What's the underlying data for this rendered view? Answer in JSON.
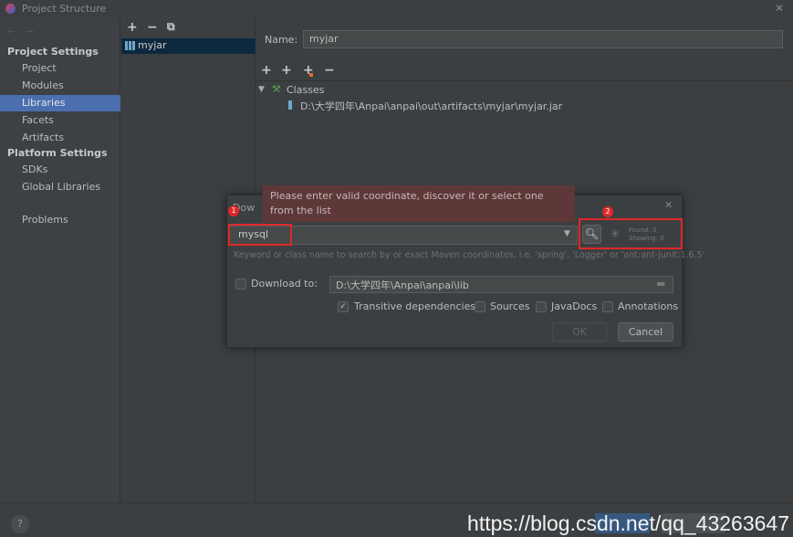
{
  "window": {
    "title": "Project Structure",
    "close": "✕"
  },
  "nav": {
    "back": "←",
    "forward": "→"
  },
  "sidebar": {
    "project_settings": "Project Settings",
    "platform_settings": "Platform Settings",
    "items": [
      {
        "label": "Project"
      },
      {
        "label": "Modules"
      },
      {
        "label": "Libraries",
        "selected": true
      },
      {
        "label": "Facets"
      },
      {
        "label": "Artifacts"
      }
    ],
    "platform_items": [
      {
        "label": "SDKs"
      },
      {
        "label": "Global Libraries"
      }
    ],
    "problems": "Problems"
  },
  "library_list": {
    "add": "+",
    "remove": "−",
    "copy": "⧉",
    "items": [
      {
        "label": "myjar"
      }
    ]
  },
  "details": {
    "name_label": "Name:",
    "name_value": "myjar",
    "toolbar": [
      "+",
      "+",
      "+",
      "−"
    ],
    "classes_label": "Classes",
    "class_path": "D:\\大学四年\\Anpai\\anpai\\out\\artifacts\\myjar\\myjar.jar"
  },
  "dialog": {
    "title": "Dow",
    "tooltip": "Please enter valid coordinate, discover it or select one from the list",
    "search_value": "mysql",
    "found": "Found: 0",
    "showing": "Showing: 0",
    "hint": "Keyword or class name to search by or exact Maven coordinates, i.e. 'spring', 'Logger' or 'ant:ant-junit:1.6.5'",
    "download_to_label": "Download to:",
    "download_to_checked": false,
    "download_path": "D:\\大学四年\\Anpai\\anpai\\lib",
    "transitive": "Transitive dependencies",
    "transitive_checked": true,
    "sources": "Sources",
    "javadocs": "JavaDocs",
    "annotations": "Annotations",
    "ok": "OK",
    "cancel": "Cancel",
    "close": "✕",
    "annotation_1": "1",
    "annotation_2": "2"
  },
  "footer": {
    "help": "?",
    "watermark": "https://blog.csdn.net/qq_43263647"
  }
}
